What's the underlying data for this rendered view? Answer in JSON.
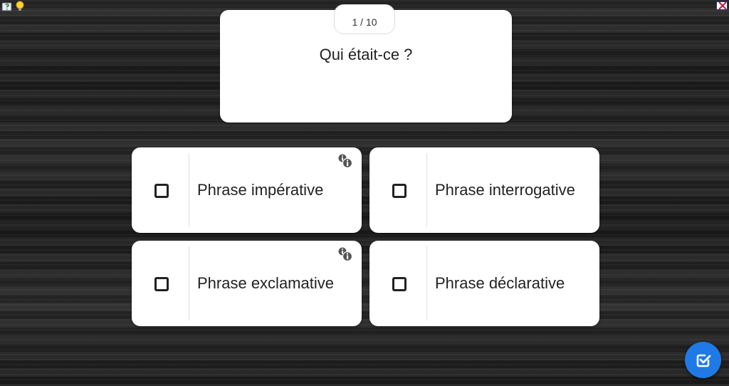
{
  "toolbar": {
    "help_icon": "help-icon",
    "hint_icon": "lightbulb-icon",
    "language_flag": "uk-flag-icon"
  },
  "question": {
    "counter": "1 / 10",
    "text": "Qui était-ce ?"
  },
  "answers": [
    {
      "label": "Phrase impérative",
      "has_info": true,
      "checked": false
    },
    {
      "label": "Phrase interrogative",
      "has_info": false,
      "checked": false
    },
    {
      "label": "Phrase exclamative",
      "has_info": true,
      "checked": false
    },
    {
      "label": "Phrase déclarative",
      "has_info": false,
      "checked": false
    }
  ],
  "validate": {
    "icon": "check-square-icon",
    "color": "#1f7ae6"
  }
}
